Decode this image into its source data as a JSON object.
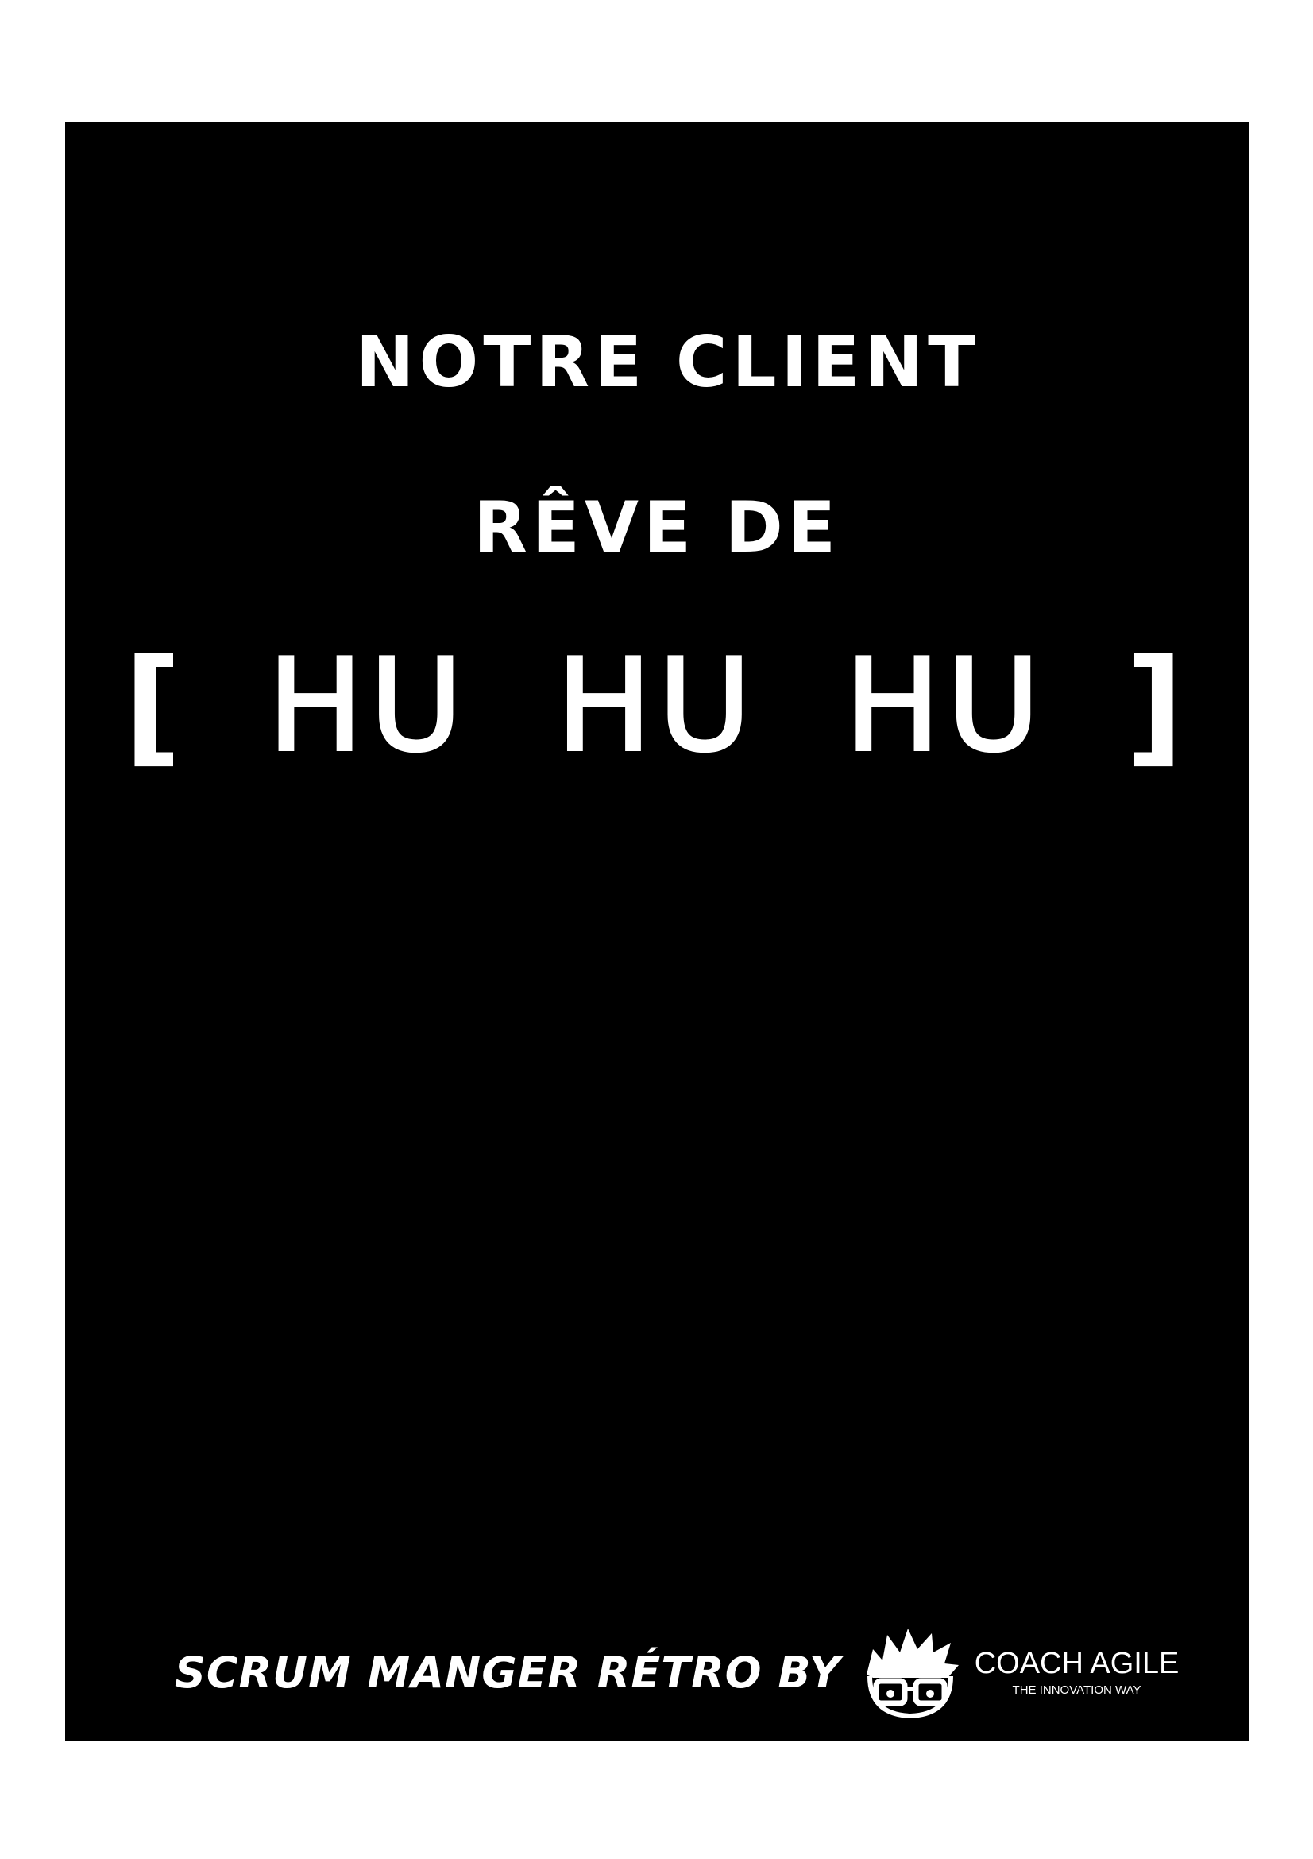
{
  "card": {
    "line1": "NOTRE CLIENT",
    "line2": "RÊVE DE",
    "line3": {
      "open_bracket": "[",
      "words": [
        "HU",
        "HU",
        "HU"
      ],
      "close_bracket": "]"
    }
  },
  "footer": {
    "tagline": "SCRUM MANGER RÉTRO BY",
    "logo_icon": "cartoon-face-with-glasses-icon",
    "brand_name": "COACH AGILE",
    "brand_subtitle": "THE INNOVATION WAY"
  },
  "colors": {
    "page_background": "#ffffff",
    "card_background": "#000000",
    "text": "#ffffff"
  }
}
